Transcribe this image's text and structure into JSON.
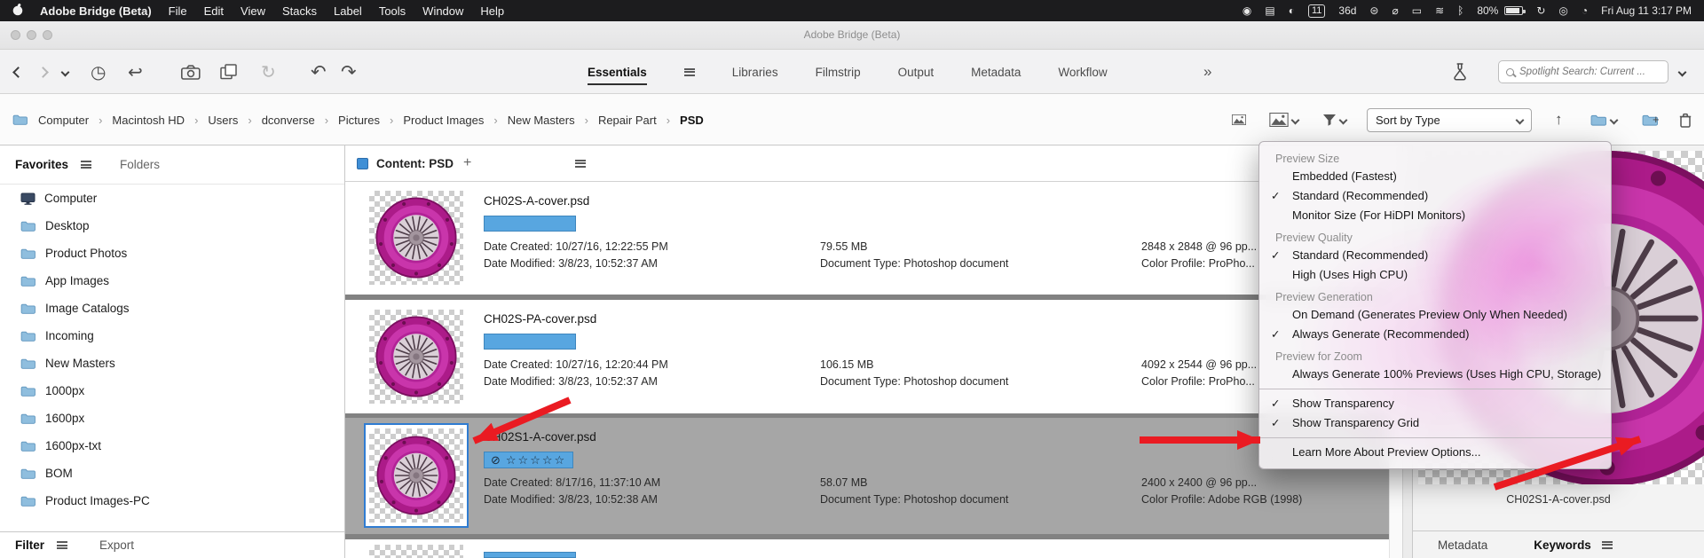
{
  "colors": {
    "accent_blue": "#3f8fd6",
    "label_blue": "#58a6e0",
    "magenta": "#b01e8c",
    "selection_gray": "#a6a6a6",
    "arrow_red": "#ea1b22"
  },
  "menubar": {
    "app_name": "Adobe Bridge (Beta)",
    "items": [
      "File",
      "Edit",
      "View",
      "Stacks",
      "Label",
      "Tools",
      "Window",
      "Help"
    ],
    "status": [
      {
        "name": "screen-record",
        "glyph": "◉"
      },
      {
        "name": "keyboard",
        "glyph": "▤"
      },
      {
        "name": "contrast",
        "glyph": "◐"
      },
      {
        "name": "notification-count",
        "glyph": "11"
      },
      {
        "name": "fitness",
        "glyph": "36d"
      },
      {
        "name": "time-machine",
        "glyph": "⊜"
      },
      {
        "name": "do-not-disturb",
        "glyph": "⌀"
      },
      {
        "name": "display",
        "glyph": "▭"
      },
      {
        "name": "airplay",
        "glyph": "≋"
      },
      {
        "name": "bluetooth",
        "glyph": "ᛒ"
      },
      {
        "name": "battery",
        "glyph": "80%"
      },
      {
        "name": "sync",
        "glyph": "↻"
      },
      {
        "name": "spotlight",
        "glyph": "◎"
      },
      {
        "name": "control-center",
        "glyph": "◔"
      }
    ],
    "clock": "Fri Aug 11  3:17 PM"
  },
  "window": {
    "title": "Adobe Bridge (Beta)"
  },
  "toolbar": {
    "workspaces": [
      {
        "label": "Essentials"
      },
      {
        "label": "Libraries"
      },
      {
        "label": "Filmstrip"
      },
      {
        "label": "Output"
      },
      {
        "label": "Metadata"
      },
      {
        "label": "Workflow"
      }
    ],
    "overflow_chevrons": "»",
    "search": {
      "placeholder": "Spotlight Search: Current ..."
    }
  },
  "pathbar": {
    "breadcrumb": [
      "Computer",
      "Macintosh HD",
      "Users",
      "dconverse",
      "Pictures",
      "Product Images",
      "New Masters",
      "Repair Part",
      "PSD"
    ],
    "sort_label": "Sort by Type"
  },
  "sidebar": {
    "tabs": [
      {
        "label": "Favorites"
      },
      {
        "label": "Folders"
      }
    ],
    "items": [
      "Computer",
      "Desktop",
      "Product Photos",
      "App Images",
      "Image Catalogs",
      "Incoming",
      "New Masters",
      "1000px",
      "1600px",
      "1600px-txt",
      "BOM",
      "Product Images-PC"
    ],
    "bottom_tabs": [
      {
        "label": "Filter"
      },
      {
        "label": "Export"
      }
    ]
  },
  "content": {
    "header": {
      "label": "Content: PSD",
      "add": "+"
    },
    "files": [
      {
        "name": "CH02S-A-cover.psd",
        "date_created": "Date Created: 10/27/16, 12:22:55 PM",
        "date_modified": "Date Modified: 3/8/23, 10:52:37 AM",
        "size": "79.55 MB",
        "doc_type": "Document Type: Photoshop document",
        "dimensions": "2848 x 2848 @ 96 pp...",
        "color_profile": "Color Profile: ProPho..."
      },
      {
        "name": "CH02S-PA-cover.psd",
        "date_created": "Date Created: 10/27/16, 12:20:44 PM",
        "date_modified": "Date Modified: 3/8/23, 10:52:37 AM",
        "size": "106.15 MB",
        "doc_type": "Document Type: Photoshop document",
        "dimensions": "4092 x 2544 @ 96 pp...",
        "color_profile": "Color Profile: ProPho..."
      },
      {
        "name": "CH02S1-A-cover.psd",
        "reject_glyph": "⊘",
        "stars": "☆☆☆☆☆",
        "date_created": "Date Created: 8/17/16, 11:37:10 AM",
        "date_modified": "Date Modified: 3/8/23, 10:52:38 AM",
        "size": "58.07 MB",
        "doc_type": "Document Type: Photoshop document",
        "dimensions": "2400 x 2400 @ 96 pp...",
        "color_profile": "Color Profile: Adobe RGB (1998)",
        "selected": true
      }
    ]
  },
  "preview_menu": {
    "groups": [
      {
        "header": "Preview Size",
        "items": [
          {
            "check": "",
            "label": "Embedded (Fastest)"
          },
          {
            "check": "✓",
            "label": "Standard (Recommended)"
          },
          {
            "check": "",
            "label": "Monitor Size (For HiDPI Monitors)"
          }
        ]
      },
      {
        "header": "Preview Quality",
        "items": [
          {
            "check": "✓",
            "label": "Standard (Recommended)"
          },
          {
            "check": "",
            "label": "High (Uses High CPU)"
          }
        ]
      },
      {
        "header": "Preview Generation",
        "items": [
          {
            "check": "",
            "label": "On Demand (Generates Preview Only When Needed)"
          },
          {
            "check": "✓",
            "label": "Always Generate (Recommended)"
          }
        ]
      },
      {
        "header": "Preview for Zoom",
        "items": [
          {
            "check": "",
            "label": "Always Generate 100% Previews (Uses High CPU, Storage)"
          }
        ]
      },
      {
        "header": "",
        "items": [
          {
            "check": "✓",
            "label": "Show Transparency"
          },
          {
            "check": "✓",
            "label": "Show Transparency Grid"
          }
        ]
      },
      {
        "header": "",
        "items": [
          {
            "check": "",
            "label": "Learn More About Preview Options..."
          }
        ]
      }
    ]
  },
  "preview_panel": {
    "filename": "CH02S1-A-cover.psd",
    "tabs": [
      {
        "label": "Metadata"
      },
      {
        "label": "Keywords"
      }
    ]
  }
}
